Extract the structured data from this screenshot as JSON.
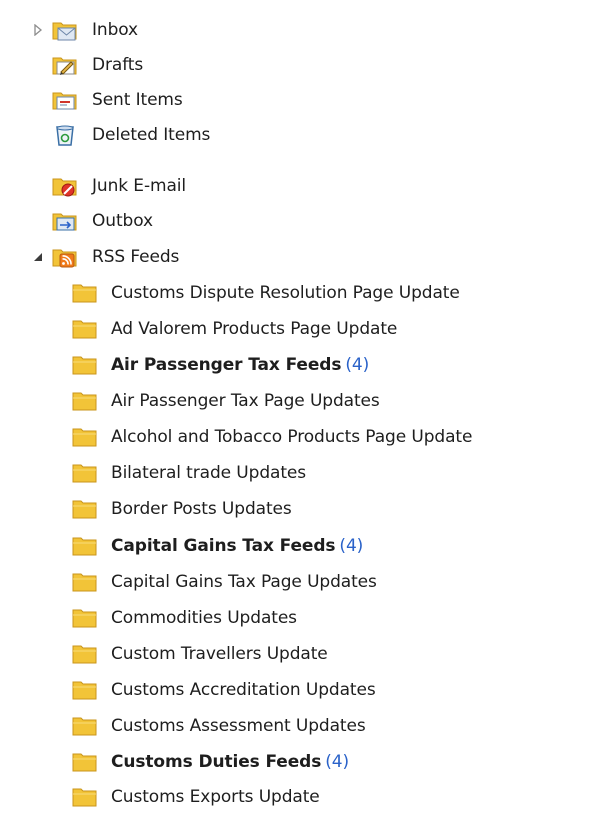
{
  "mail_folders": [
    {
      "label": "Inbox",
      "icon": "inbox-icon",
      "expander": "collapsed"
    },
    {
      "label": "Drafts",
      "icon": "drafts-icon"
    },
    {
      "label": "Sent Items",
      "icon": "sent-items-icon"
    },
    {
      "label": "Deleted Items",
      "icon": "deleted-items-icon"
    },
    {
      "label": "Junk E-mail",
      "icon": "junk-email-icon"
    },
    {
      "label": "Outbox",
      "icon": "outbox-icon"
    },
    {
      "label": "RSS Feeds",
      "icon": "rss-feeds-icon",
      "expander": "expanded"
    }
  ],
  "rss_feeds": [
    {
      "label": " Customs Dispute Resolution Page Update",
      "count": ""
    },
    {
      "label": "Ad Valorem Products Page Update",
      "count": ""
    },
    {
      "label": "Air Passenger Tax Feeds",
      "count": "(4)",
      "bold": true
    },
    {
      "label": "Air Passenger Tax Page Updates",
      "count": ""
    },
    {
      "label": "Alcohol and Tobacco Products Page Update",
      "count": ""
    },
    {
      "label": "Bilateral trade Updates",
      "count": ""
    },
    {
      "label": "Border Posts Updates",
      "count": ""
    },
    {
      "label": "Capital Gains Tax Feeds",
      "count": "(4)",
      "bold": true
    },
    {
      "label": "Capital Gains Tax Page Updates",
      "count": ""
    },
    {
      "label": "Commodities Updates",
      "count": ""
    },
    {
      "label": "Custom Travellers Update",
      "count": ""
    },
    {
      "label": "Customs Accreditation Updates",
      "count": ""
    },
    {
      "label": "Customs Assessment Updates",
      "count": ""
    },
    {
      "label": "Customs Duties Feeds",
      "count": "(4)",
      "bold": true
    },
    {
      "label": "Customs Exports Update",
      "count": ""
    }
  ],
  "colors": {
    "folder_yellow": "#f2c438",
    "folder_edge": "#c9951b",
    "count_blue": "#2a62c9",
    "rss_orange": "#f07a1a"
  }
}
